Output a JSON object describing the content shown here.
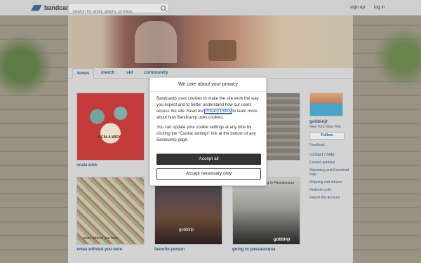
{
  "topbar": {
    "logo_text": "bandcamp",
    "search_placeholder": "Search for artist, album, or track",
    "signup": "sign up",
    "login": "log in"
  },
  "tabs": [
    "tunes",
    "merch",
    "vid",
    "community"
  ],
  "albums": [
    {
      "title": "ocala wick"
    },
    {
      "title": ""
    },
    {
      "title": ""
    },
    {
      "title": "xmas without you here"
    },
    {
      "title": "favorite person"
    },
    {
      "title": "going to passalacqua"
    }
  ],
  "album_art_text": {
    "a1": "OCALA WICK",
    "a4": "xmas without you here",
    "a5": "gobbinjr",
    "a6_top": "Going to Passalacqua",
    "a6_bottom": "gobbinjr"
  },
  "sidebar": {
    "name": "gobbinjr",
    "location": "New York, New York",
    "follow": "Follow",
    "facebook": "Facebook",
    "contact_head": "contact / help",
    "links": [
      "Contact gobbinjr",
      "Streaming and Download help",
      "Shipping and returns",
      "Redeem code",
      "Report this account"
    ]
  },
  "cookie_modal": {
    "title": "We care about your privacy",
    "p1_before": "Bandcamp uses cookies to make the site work the way you expect and to better understand how our users access the site. Read our ",
    "privacy_link": "Privacy Policy",
    "p1_after": " to learn more about how Bandcamp uses cookies.",
    "p2": "You can update your cookie settings at any time by clicking the “Cookie settings” link at the bottom of any Bandcamp page.",
    "accept_all": "Accept all",
    "accept_necessary": "Accept necessary only"
  },
  "colors": {
    "link": "#2d5a8a",
    "accept_button": "#333333",
    "topbar": "#cfcfcf"
  }
}
